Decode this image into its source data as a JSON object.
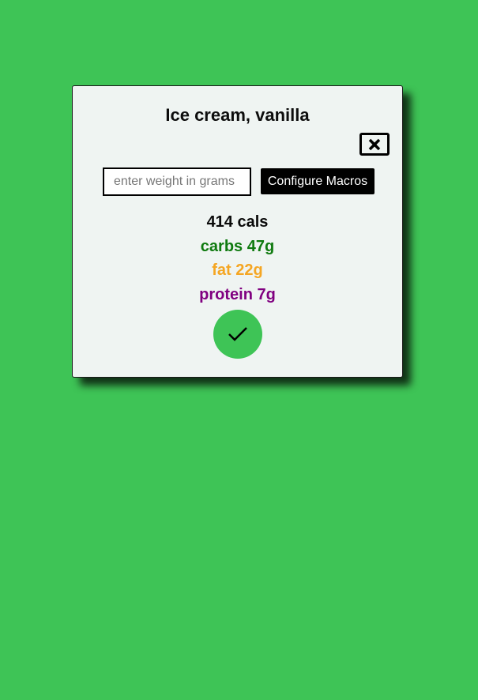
{
  "modal": {
    "title": "Ice cream, vanilla",
    "close_icon": "close-icon",
    "weight_input": {
      "placeholder": "enter weight in grams",
      "value": ""
    },
    "configure_label": "Configure Macros",
    "macros": {
      "cals": "414 cals",
      "carbs": "carbs 47g",
      "fat": "fat 22g",
      "protein": "protein 7g"
    },
    "confirm_icon": "checkmark-icon"
  },
  "colors": {
    "background": "#3ec456",
    "modal_bg": "#eff4f2",
    "carbs": "#0f7a0f",
    "fat": "#f5a623",
    "protein": "#800080",
    "confirm_button": "#3ec456"
  }
}
